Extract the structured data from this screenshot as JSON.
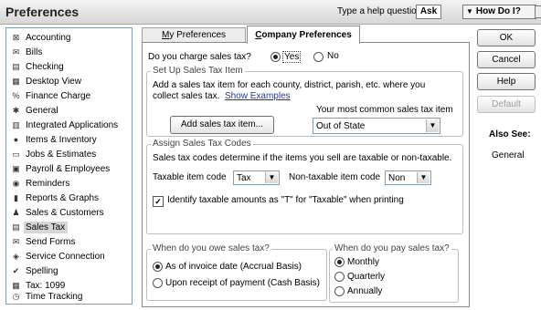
{
  "window": {
    "title": "Preferences",
    "help_placeholder": "Type a help question",
    "ask_label": "Ask",
    "how_do_i_label": "How Do I?"
  },
  "sidebar": {
    "items": [
      {
        "label": "Accounting",
        "icon": "accounting-icon",
        "glyph": "⊠"
      },
      {
        "label": "Bills",
        "icon": "bills-icon",
        "glyph": "✉"
      },
      {
        "label": "Checking",
        "icon": "checking-icon",
        "glyph": "▤"
      },
      {
        "label": "Desktop View",
        "icon": "desktop-view-icon",
        "glyph": "▦"
      },
      {
        "label": "Finance Charge",
        "icon": "finance-charge-icon",
        "glyph": "%"
      },
      {
        "label": "General",
        "icon": "general-icon",
        "glyph": "✱"
      },
      {
        "label": "Integrated Applications",
        "icon": "integrated-applications-icon",
        "glyph": "▥"
      },
      {
        "label": "Items & Inventory",
        "icon": "items-inventory-icon",
        "glyph": "●"
      },
      {
        "label": "Jobs & Estimates",
        "icon": "jobs-estimates-icon",
        "glyph": "▭"
      },
      {
        "label": "Payroll & Employees",
        "icon": "payroll-employees-icon",
        "glyph": "▣"
      },
      {
        "label": "Reminders",
        "icon": "reminders-icon",
        "glyph": "◉"
      },
      {
        "label": "Reports & Graphs",
        "icon": "reports-graphs-icon",
        "glyph": "▮"
      },
      {
        "label": "Sales & Customers",
        "icon": "sales-customers-icon",
        "glyph": "♟"
      },
      {
        "label": "Sales Tax",
        "icon": "sales-tax-icon",
        "glyph": "▤"
      },
      {
        "label": "Send Forms",
        "icon": "send-forms-icon",
        "glyph": "✉"
      },
      {
        "label": "Service Connection",
        "icon": "service-connection-icon",
        "glyph": "◈"
      },
      {
        "label": "Spelling",
        "icon": "spelling-icon",
        "glyph": "✔"
      },
      {
        "label": "Tax: 1099",
        "icon": "tax-1099-icon",
        "glyph": "▦"
      },
      {
        "label": "Time Tracking",
        "icon": "time-tracking-icon",
        "glyph": "◷"
      }
    ],
    "selected": "Sales Tax"
  },
  "tabs": {
    "my_prefix": "",
    "my_underline": "M",
    "my_rest": "y Preferences",
    "company_prefix": "",
    "company_underline": "C",
    "company_rest": "ompany Preferences"
  },
  "content": {
    "charge_question": "Do you charge sales tax?",
    "charge_yes": "Yes",
    "charge_no": "No",
    "charge_selected": "Yes",
    "setup_group_title": "Set Up Sales Tax Item",
    "setup_line1": "Add a sales tax item for each county, district, parish, etc. where you",
    "setup_line2": "collect sales tax.",
    "show_examples": "Show Examples",
    "add_item_button": "Add sales tax item...",
    "common_item_label": "Your most common sales tax item",
    "common_item_value": "Out of State",
    "assign_group_title": "Assign Sales Tax Codes",
    "assign_desc": "Sales tax codes determine if the items you sell are taxable or non-taxable.",
    "taxable_code_label": "Taxable item code",
    "taxable_code_value": "Tax",
    "nontaxable_code_label": "Non-taxable item code",
    "nontaxable_code_value": "Non",
    "identify_label": "Identify taxable amounts as \"T\" for \"Taxable\" when printing",
    "identify_checked": true,
    "owe_group_title": "When do you owe sales tax?",
    "owe_option1": "As of invoice date (Accrual Basis)",
    "owe_option2": "Upon receipt of payment (Cash Basis)",
    "owe_selected": "As of invoice date (Accrual Basis)",
    "pay_group_title": "When do you pay sales tax?",
    "pay_option1": "Monthly",
    "pay_option2": "Quarterly",
    "pay_option3": "Annually",
    "pay_selected": "Monthly"
  },
  "buttons": {
    "ok": "OK",
    "cancel": "Cancel",
    "help": "Help",
    "default": "Default"
  },
  "also_see": {
    "heading": "Also See:",
    "link": "General"
  },
  "colors": {
    "selected_item_bg": "#d6d6d6",
    "link": "#1a3aa6",
    "title_bar": "#d6d6d6"
  }
}
